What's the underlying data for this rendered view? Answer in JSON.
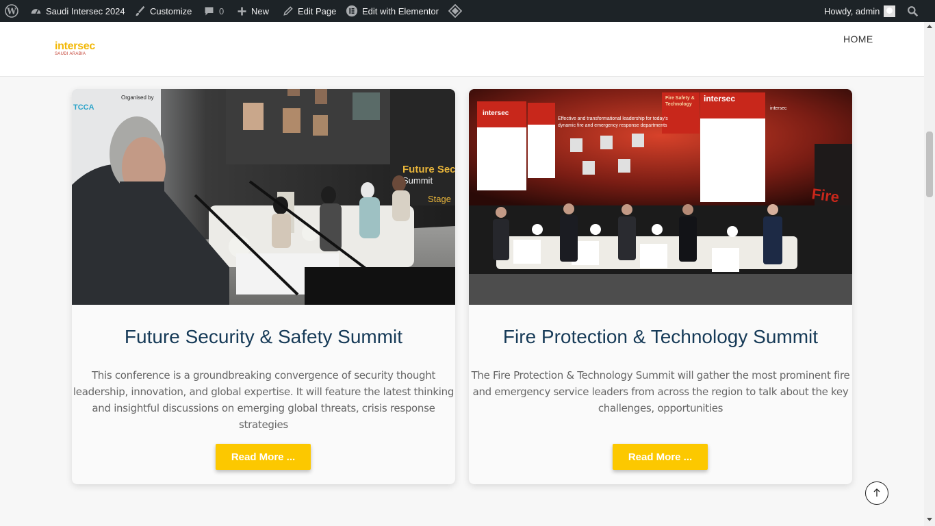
{
  "adminbar": {
    "site_name": "Saudi Intersec 2024",
    "customize": "Customize",
    "comments_count": "0",
    "new": "New",
    "edit_page": "Edit Page",
    "edit_elementor": "Edit with Elementor",
    "howdy": "Howdy, admin"
  },
  "header": {
    "logo_line1": "intersec",
    "logo_line2": "SAUDI ARABIA",
    "nav": [
      "HOME"
    ]
  },
  "cards": [
    {
      "title": "Future Security & Safety Summit",
      "description": "This conference is a groundbreaking convergence of security thought leadership, innovation, and global expertise. It will feature the latest thinking and insightful discussions on emerging global threats, crisis response strategies",
      "button": "Read More ...",
      "image_screen_text": "Future Sec Summit Stage",
      "image_org_text": "Organised by"
    },
    {
      "title": "Fire Protection & Technology Summit",
      "description": "The Fire Protection & Technology Summit will gather the most prominent fire and emergency service leaders from across the region to talk about the key challenges, opportunities",
      "button": "Read More ...",
      "image_screen_title": "Effective and transformational leadership for today's dynamic fire and emergency response departments",
      "image_brand": "intersec",
      "image_side": "Fire Safety & Technology Summit"
    }
  ],
  "colors": {
    "adminbar_bg": "#1d2327",
    "title": "#163a57",
    "button": "#fcc800",
    "logo": "#f2b705"
  }
}
